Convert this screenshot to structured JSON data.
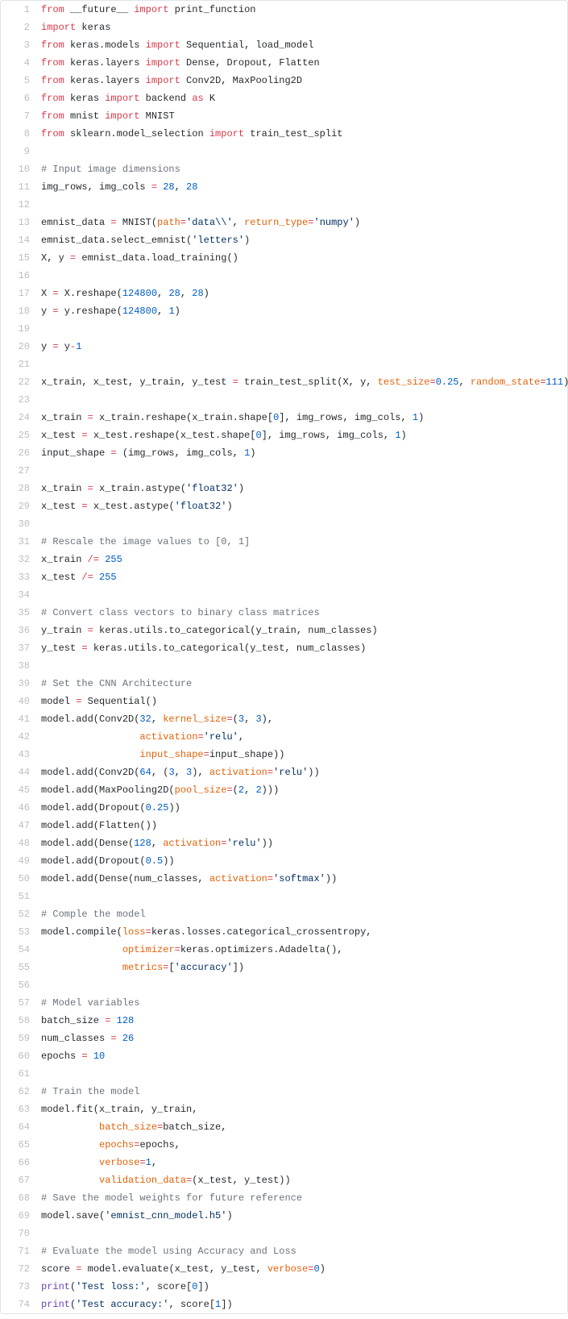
{
  "lines": [
    {
      "n": 1,
      "t": [
        [
          "kw",
          "from"
        ],
        [
          "id",
          " __future__ "
        ],
        [
          "kw",
          "import"
        ],
        [
          "id",
          " print_function"
        ]
      ]
    },
    {
      "n": 2,
      "t": [
        [
          "kw",
          "import"
        ],
        [
          "id",
          " keras"
        ]
      ]
    },
    {
      "n": 3,
      "t": [
        [
          "kw",
          "from"
        ],
        [
          "id",
          " keras.models "
        ],
        [
          "kw",
          "import"
        ],
        [
          "id",
          " Sequential, load_model"
        ]
      ]
    },
    {
      "n": 4,
      "t": [
        [
          "kw",
          "from"
        ],
        [
          "id",
          " keras.layers "
        ],
        [
          "kw",
          "import"
        ],
        [
          "id",
          " Dense, Dropout, Flatten"
        ]
      ]
    },
    {
      "n": 5,
      "t": [
        [
          "kw",
          "from"
        ],
        [
          "id",
          " keras.layers "
        ],
        [
          "kw",
          "import"
        ],
        [
          "id",
          " Conv2D, MaxPooling2D"
        ]
      ]
    },
    {
      "n": 6,
      "t": [
        [
          "kw",
          "from"
        ],
        [
          "id",
          " keras "
        ],
        [
          "kw",
          "import"
        ],
        [
          "id",
          " backend "
        ],
        [
          "kw",
          "as"
        ],
        [
          "id",
          " K"
        ]
      ]
    },
    {
      "n": 7,
      "t": [
        [
          "kw",
          "from"
        ],
        [
          "id",
          " mnist "
        ],
        [
          "kw",
          "import"
        ],
        [
          "id",
          " MNIST"
        ]
      ]
    },
    {
      "n": 8,
      "t": [
        [
          "kw",
          "from"
        ],
        [
          "id",
          " sklearn.model_selection "
        ],
        [
          "kw",
          "import"
        ],
        [
          "id",
          " train_test_split"
        ]
      ]
    },
    {
      "n": 9,
      "t": []
    },
    {
      "n": 10,
      "t": [
        [
          "com",
          "# Input image dimensions"
        ]
      ]
    },
    {
      "n": 11,
      "t": [
        [
          "id",
          "img_rows, img_cols "
        ],
        [
          "kw",
          "="
        ],
        [
          "id",
          " "
        ],
        [
          "num-lit",
          "28"
        ],
        [
          "id",
          ", "
        ],
        [
          "num-lit",
          "28"
        ]
      ]
    },
    {
      "n": 12,
      "t": []
    },
    {
      "n": 13,
      "t": [
        [
          "id",
          "emnist_data "
        ],
        [
          "kw",
          "="
        ],
        [
          "id",
          " MNIST("
        ],
        [
          "arg",
          "path"
        ],
        [
          "kw",
          "="
        ],
        [
          "str",
          "'data\\\\'"
        ],
        [
          "id",
          ", "
        ],
        [
          "arg",
          "return_type"
        ],
        [
          "kw",
          "="
        ],
        [
          "str",
          "'numpy'"
        ],
        [
          "id",
          ")"
        ]
      ]
    },
    {
      "n": 14,
      "t": [
        [
          "id",
          "emnist_data.select_emnist("
        ],
        [
          "str",
          "'letters'"
        ],
        [
          "id",
          ")"
        ]
      ]
    },
    {
      "n": 15,
      "t": [
        [
          "id",
          "X, y "
        ],
        [
          "kw",
          "="
        ],
        [
          "id",
          " emnist_data.load_training()"
        ]
      ]
    },
    {
      "n": 16,
      "t": []
    },
    {
      "n": 17,
      "t": [
        [
          "id",
          "X "
        ],
        [
          "kw",
          "="
        ],
        [
          "id",
          " X.reshape("
        ],
        [
          "num-lit",
          "124800"
        ],
        [
          "id",
          ", "
        ],
        [
          "num-lit",
          "28"
        ],
        [
          "id",
          ", "
        ],
        [
          "num-lit",
          "28"
        ],
        [
          "id",
          ")"
        ]
      ]
    },
    {
      "n": 18,
      "t": [
        [
          "id",
          "y "
        ],
        [
          "kw",
          "="
        ],
        [
          "id",
          " y.reshape("
        ],
        [
          "num-lit",
          "124800"
        ],
        [
          "id",
          ", "
        ],
        [
          "num-lit",
          "1"
        ],
        [
          "id",
          ")"
        ]
      ]
    },
    {
      "n": 19,
      "t": []
    },
    {
      "n": 20,
      "t": [
        [
          "id",
          "y "
        ],
        [
          "kw",
          "="
        ],
        [
          "id",
          " y"
        ],
        [
          "kw",
          "-"
        ],
        [
          "num-lit",
          "1"
        ]
      ]
    },
    {
      "n": 21,
      "t": []
    },
    {
      "n": 22,
      "t": [
        [
          "id",
          "x_train, x_test, y_train, y_test "
        ],
        [
          "kw",
          "="
        ],
        [
          "id",
          " train_test_split(X, y, "
        ],
        [
          "arg",
          "test_size"
        ],
        [
          "kw",
          "="
        ],
        [
          "num-lit",
          "0.25"
        ],
        [
          "id",
          ", "
        ],
        [
          "arg",
          "random_state"
        ],
        [
          "kw",
          "="
        ],
        [
          "num-lit",
          "111"
        ],
        [
          "id",
          ")"
        ]
      ]
    },
    {
      "n": 23,
      "t": []
    },
    {
      "n": 24,
      "t": [
        [
          "id",
          "x_train "
        ],
        [
          "kw",
          "="
        ],
        [
          "id",
          " x_train.reshape(x_train.shape["
        ],
        [
          "num-lit",
          "0"
        ],
        [
          "id",
          "], img_rows, img_cols, "
        ],
        [
          "num-lit",
          "1"
        ],
        [
          "id",
          ")"
        ]
      ]
    },
    {
      "n": 25,
      "t": [
        [
          "id",
          "x_test "
        ],
        [
          "kw",
          "="
        ],
        [
          "id",
          " x_test.reshape(x_test.shape["
        ],
        [
          "num-lit",
          "0"
        ],
        [
          "id",
          "], img_rows, img_cols, "
        ],
        [
          "num-lit",
          "1"
        ],
        [
          "id",
          ")"
        ]
      ]
    },
    {
      "n": 26,
      "t": [
        [
          "id",
          "input_shape "
        ],
        [
          "kw",
          "="
        ],
        [
          "id",
          " (img_rows, img_cols, "
        ],
        [
          "num-lit",
          "1"
        ],
        [
          "id",
          ")"
        ]
      ]
    },
    {
      "n": 27,
      "t": []
    },
    {
      "n": 28,
      "t": [
        [
          "id",
          "x_train "
        ],
        [
          "kw",
          "="
        ],
        [
          "id",
          " x_train.astype("
        ],
        [
          "str",
          "'float32'"
        ],
        [
          "id",
          ")"
        ]
      ]
    },
    {
      "n": 29,
      "t": [
        [
          "id",
          "x_test "
        ],
        [
          "kw",
          "="
        ],
        [
          "id",
          " x_test.astype("
        ],
        [
          "str",
          "'float32'"
        ],
        [
          "id",
          ")"
        ]
      ]
    },
    {
      "n": 30,
      "t": []
    },
    {
      "n": 31,
      "t": [
        [
          "com",
          "# Rescale the image values to [0, 1]"
        ]
      ]
    },
    {
      "n": 32,
      "t": [
        [
          "id",
          "x_train "
        ],
        [
          "kw",
          "/="
        ],
        [
          "id",
          " "
        ],
        [
          "num-lit",
          "255"
        ]
      ]
    },
    {
      "n": 33,
      "t": [
        [
          "id",
          "x_test "
        ],
        [
          "kw",
          "/="
        ],
        [
          "id",
          " "
        ],
        [
          "num-lit",
          "255"
        ]
      ]
    },
    {
      "n": 34,
      "t": []
    },
    {
      "n": 35,
      "t": [
        [
          "com",
          "# Convert class vectors to binary class matrices"
        ]
      ]
    },
    {
      "n": 36,
      "t": [
        [
          "id",
          "y_train "
        ],
        [
          "kw",
          "="
        ],
        [
          "id",
          " keras.utils.to_categorical(y_train, num_classes)"
        ]
      ]
    },
    {
      "n": 37,
      "t": [
        [
          "id",
          "y_test "
        ],
        [
          "kw",
          "="
        ],
        [
          "id",
          " keras.utils.to_categorical(y_test, num_classes)"
        ]
      ]
    },
    {
      "n": 38,
      "t": []
    },
    {
      "n": 39,
      "t": [
        [
          "com",
          "# Set the CNN Architecture"
        ]
      ]
    },
    {
      "n": 40,
      "t": [
        [
          "id",
          "model "
        ],
        [
          "kw",
          "="
        ],
        [
          "id",
          " Sequential()"
        ]
      ]
    },
    {
      "n": 41,
      "t": [
        [
          "id",
          "model.add(Conv2D("
        ],
        [
          "num-lit",
          "32"
        ],
        [
          "id",
          ", "
        ],
        [
          "arg",
          "kernel_size"
        ],
        [
          "kw",
          "="
        ],
        [
          "id",
          "("
        ],
        [
          "num-lit",
          "3"
        ],
        [
          "id",
          ", "
        ],
        [
          "num-lit",
          "3"
        ],
        [
          "id",
          "),"
        ]
      ]
    },
    {
      "n": 42,
      "t": [
        [
          "id",
          "                 "
        ],
        [
          "arg",
          "activation"
        ],
        [
          "kw",
          "="
        ],
        [
          "str",
          "'relu'"
        ],
        [
          "id",
          ","
        ]
      ]
    },
    {
      "n": 43,
      "t": [
        [
          "id",
          "                 "
        ],
        [
          "arg",
          "input_shape"
        ],
        [
          "kw",
          "="
        ],
        [
          "id",
          "input_shape))"
        ]
      ]
    },
    {
      "n": 44,
      "t": [
        [
          "id",
          "model.add(Conv2D("
        ],
        [
          "num-lit",
          "64"
        ],
        [
          "id",
          ", ("
        ],
        [
          "num-lit",
          "3"
        ],
        [
          "id",
          ", "
        ],
        [
          "num-lit",
          "3"
        ],
        [
          "id",
          "), "
        ],
        [
          "arg",
          "activation"
        ],
        [
          "kw",
          "="
        ],
        [
          "str",
          "'relu'"
        ],
        [
          "id",
          "))"
        ]
      ]
    },
    {
      "n": 45,
      "t": [
        [
          "id",
          "model.add(MaxPooling2D("
        ],
        [
          "arg",
          "pool_size"
        ],
        [
          "kw",
          "="
        ],
        [
          "id",
          "("
        ],
        [
          "num-lit",
          "2"
        ],
        [
          "id",
          ", "
        ],
        [
          "num-lit",
          "2"
        ],
        [
          "id",
          ")))"
        ]
      ]
    },
    {
      "n": 46,
      "t": [
        [
          "id",
          "model.add(Dropout("
        ],
        [
          "num-lit",
          "0.25"
        ],
        [
          "id",
          "))"
        ]
      ]
    },
    {
      "n": 47,
      "t": [
        [
          "id",
          "model.add(Flatten())"
        ]
      ]
    },
    {
      "n": 48,
      "t": [
        [
          "id",
          "model.add(Dense("
        ],
        [
          "num-lit",
          "128"
        ],
        [
          "id",
          ", "
        ],
        [
          "arg",
          "activation"
        ],
        [
          "kw",
          "="
        ],
        [
          "str",
          "'relu'"
        ],
        [
          "id",
          "))"
        ]
      ]
    },
    {
      "n": 49,
      "t": [
        [
          "id",
          "model.add(Dropout("
        ],
        [
          "num-lit",
          "0.5"
        ],
        [
          "id",
          "))"
        ]
      ]
    },
    {
      "n": 50,
      "t": [
        [
          "id",
          "model.add(Dense(num_classes, "
        ],
        [
          "arg",
          "activation"
        ],
        [
          "kw",
          "="
        ],
        [
          "str",
          "'softmax'"
        ],
        [
          "id",
          "))"
        ]
      ]
    },
    {
      "n": 51,
      "t": []
    },
    {
      "n": 52,
      "t": [
        [
          "com",
          "# Comple the model"
        ]
      ]
    },
    {
      "n": 53,
      "t": [
        [
          "id",
          "model.compile("
        ],
        [
          "arg",
          "loss"
        ],
        [
          "kw",
          "="
        ],
        [
          "id",
          "keras.losses.categorical_crossentropy,"
        ]
      ]
    },
    {
      "n": 54,
      "t": [
        [
          "id",
          "              "
        ],
        [
          "arg",
          "optimizer"
        ],
        [
          "kw",
          "="
        ],
        [
          "id",
          "keras.optimizers.Adadelta(),"
        ]
      ]
    },
    {
      "n": 55,
      "t": [
        [
          "id",
          "              "
        ],
        [
          "arg",
          "metrics"
        ],
        [
          "kw",
          "="
        ],
        [
          "id",
          "["
        ],
        [
          "str",
          "'accuracy'"
        ],
        [
          "id",
          "])"
        ]
      ]
    },
    {
      "n": 56,
      "t": []
    },
    {
      "n": 57,
      "t": [
        [
          "com",
          "# Model variables"
        ]
      ]
    },
    {
      "n": 58,
      "t": [
        [
          "id",
          "batch_size "
        ],
        [
          "kw",
          "="
        ],
        [
          "id",
          " "
        ],
        [
          "num-lit",
          "128"
        ]
      ]
    },
    {
      "n": 59,
      "t": [
        [
          "id",
          "num_classes "
        ],
        [
          "kw",
          "="
        ],
        [
          "id",
          " "
        ],
        [
          "num-lit",
          "26"
        ]
      ]
    },
    {
      "n": 60,
      "t": [
        [
          "id",
          "epochs "
        ],
        [
          "kw",
          "="
        ],
        [
          "id",
          " "
        ],
        [
          "num-lit",
          "10"
        ]
      ]
    },
    {
      "n": 61,
      "t": []
    },
    {
      "n": 62,
      "t": [
        [
          "com",
          "# Train the model"
        ]
      ]
    },
    {
      "n": 63,
      "t": [
        [
          "id",
          "model.fit(x_train, y_train,"
        ]
      ]
    },
    {
      "n": 64,
      "t": [
        [
          "id",
          "          "
        ],
        [
          "arg",
          "batch_size"
        ],
        [
          "kw",
          "="
        ],
        [
          "id",
          "batch_size,"
        ]
      ]
    },
    {
      "n": 65,
      "t": [
        [
          "id",
          "          "
        ],
        [
          "arg",
          "epochs"
        ],
        [
          "kw",
          "="
        ],
        [
          "id",
          "epochs,"
        ]
      ]
    },
    {
      "n": 66,
      "t": [
        [
          "id",
          "          "
        ],
        [
          "arg",
          "verbose"
        ],
        [
          "kw",
          "="
        ],
        [
          "num-lit",
          "1"
        ],
        [
          "id",
          ","
        ]
      ]
    },
    {
      "n": 67,
      "t": [
        [
          "id",
          "          "
        ],
        [
          "arg",
          "validation_data"
        ],
        [
          "kw",
          "="
        ],
        [
          "id",
          "(x_test, y_test))"
        ]
      ]
    },
    {
      "n": 68,
      "t": [
        [
          "com",
          "# Save the model weights for future reference"
        ]
      ]
    },
    {
      "n": 69,
      "t": [
        [
          "id",
          "model.save("
        ],
        [
          "str",
          "'emnist_cnn_model.h5'"
        ],
        [
          "id",
          ")"
        ]
      ]
    },
    {
      "n": 70,
      "t": []
    },
    {
      "n": 71,
      "t": [
        [
          "com",
          "# Evaluate the model using Accuracy and Loss"
        ]
      ]
    },
    {
      "n": 72,
      "t": [
        [
          "id",
          "score "
        ],
        [
          "kw",
          "="
        ],
        [
          "id",
          " model.evaluate(x_test, y_test, "
        ],
        [
          "arg",
          "verbose"
        ],
        [
          "kw",
          "="
        ],
        [
          "num-lit",
          "0"
        ],
        [
          "id",
          ")"
        ]
      ]
    },
    {
      "n": 73,
      "t": [
        [
          "fn",
          "print"
        ],
        [
          "id",
          "("
        ],
        [
          "str",
          "'Test loss:'"
        ],
        [
          "id",
          ", score["
        ],
        [
          "num-lit",
          "0"
        ],
        [
          "id",
          "])"
        ]
      ]
    },
    {
      "n": 74,
      "t": [
        [
          "fn",
          "print"
        ],
        [
          "id",
          "("
        ],
        [
          "str",
          "'Test accuracy:'"
        ],
        [
          "id",
          ", score["
        ],
        [
          "num-lit",
          "1"
        ],
        [
          "id",
          "])"
        ]
      ]
    }
  ]
}
